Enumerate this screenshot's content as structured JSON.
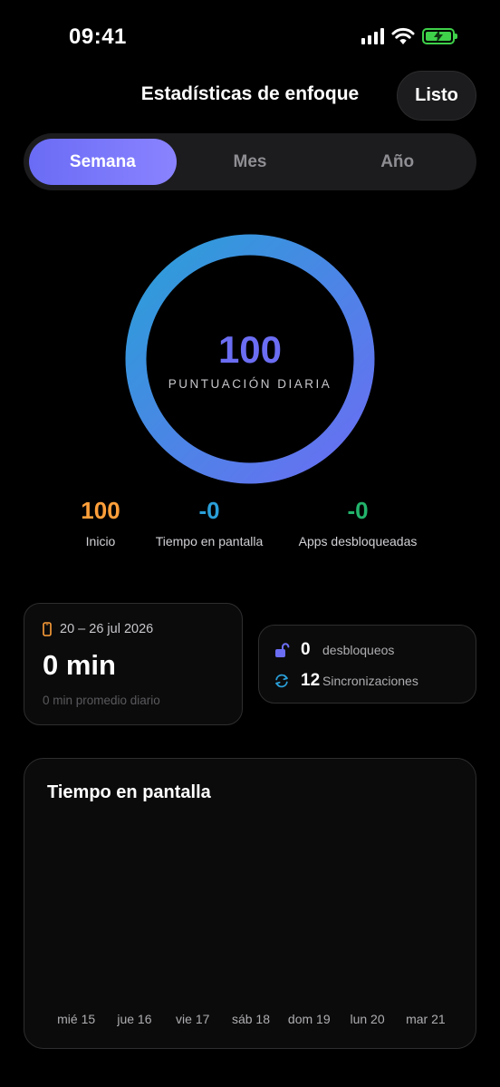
{
  "status_bar": {
    "time": "09:41"
  },
  "header": {
    "title": "Estadísticas de enfoque",
    "done_label": "Listo"
  },
  "segments": [
    {
      "label": "Semana",
      "active": true
    },
    {
      "label": "Mes",
      "active": false
    },
    {
      "label": "Año",
      "active": false
    }
  ],
  "score": {
    "value": "100",
    "label": "PUNTUACIÓN DIARIA",
    "progress": 1.0
  },
  "stats": [
    {
      "value": "100",
      "label": "Inicio",
      "color": "#ff9f3a"
    },
    {
      "value": "-0",
      "label": "Tiempo en pantalla",
      "color": "#2a9fd8"
    },
    {
      "value": "-0",
      "label": "Apps desbloqueadas",
      "color": "#22b36b"
    }
  ],
  "week": {
    "range": "20 – 26 jul 2026",
    "total": "0 min",
    "average": "0 min promedio diario"
  },
  "unlocks": {
    "unlocks_count": "0",
    "unlocks_label": "desbloqueos",
    "syncs_count": "12",
    "syncs_label": "Sincronizaciones"
  },
  "chart_data": {
    "type": "bar",
    "title": "Tiempo en pantalla",
    "categories": [
      "mié 15",
      "jue 16",
      "vie 17",
      "sáb 18",
      "dom 19",
      "lun 20",
      "mar 21"
    ],
    "values": [
      0,
      0,
      0,
      0,
      0,
      0,
      0
    ],
    "xlabel": "",
    "ylabel": ""
  },
  "colors": {
    "accent": "#6b6df3",
    "ring_start": "#2a9fd8",
    "ring_end": "#6b6df3",
    "battery": "#3fd14a",
    "phone_icon": "#ff9f3a",
    "lock_icon": "#6b6df3",
    "sync_icon": "#2a9fd8"
  }
}
